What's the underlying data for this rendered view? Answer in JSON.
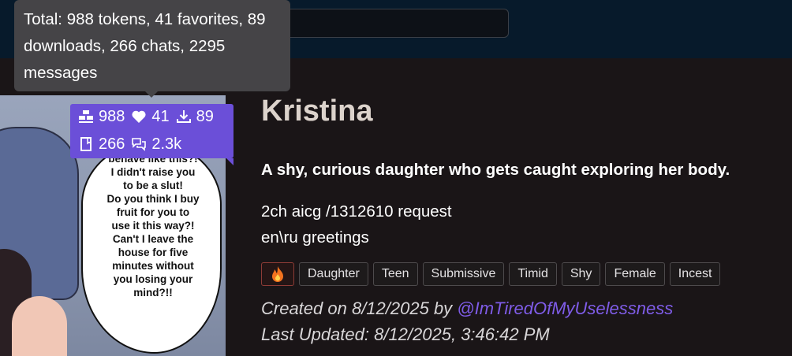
{
  "tooltip": {
    "text": "Total: 988 tokens, 41 favorites, 89 downloads, 266 chats, 2295 messages"
  },
  "stats": {
    "tokens": "988",
    "favorites": "41",
    "downloads": "89",
    "chats": "266",
    "messages": "2.3k"
  },
  "image": {
    "speech_text": "behave like this?!\nI didn't raise you\nto be a slut!\nDo you think I buy\nfruit for you to\nuse it this way?!\nCan't I leave the\nhouse for five\nminutes without\nyou losing your\nmind?!!"
  },
  "character": {
    "name": "Kristina",
    "tagline": "A shy, curious daughter who gets caught exploring her body.",
    "description_line1": "2ch aicg /1312610 request",
    "description_line2": "en\\ru greetings",
    "tags": [
      "Daughter",
      "Teen",
      "Submissive",
      "Timid",
      "Shy",
      "Female",
      "Incest"
    ],
    "created_prefix": "Created on 8/12/2025 by ",
    "author": "@ImTiredOfMyUselessness",
    "last_updated": "Last Updated: 8/12/2025, 3:46:42 PM"
  },
  "colors": {
    "badge": "#6b4fd8",
    "link": "#7f5ce8",
    "fire_border": "#8d3b36"
  }
}
